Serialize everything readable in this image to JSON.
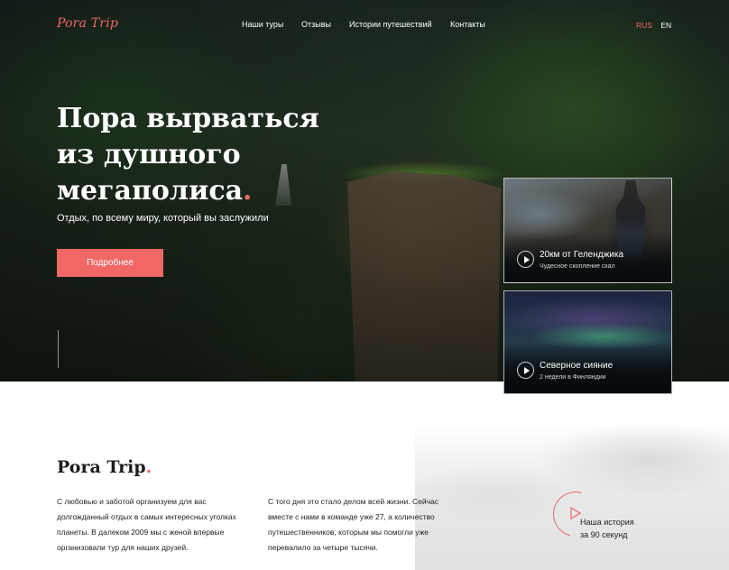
{
  "brand": {
    "logo": "Pora Trip",
    "accent_color": "#f06766"
  },
  "nav": {
    "items": [
      "Наши туры",
      "Отзывы",
      "Истории путешествий",
      "Контакты"
    ]
  },
  "lang": {
    "ru": "RUS",
    "en": "EN",
    "active": "RUS"
  },
  "hero": {
    "title_lines": [
      "Пора вырваться",
      "из душного",
      "мегаполиса"
    ],
    "title_dot": ".",
    "subtitle": "Отдых, по всему миру, который вы заслужили",
    "button": "Подробнее"
  },
  "cards": [
    {
      "title": "20км от Геленджика",
      "subtitle": "Чудесное скопление скал",
      "icon": "play-icon"
    },
    {
      "title": "Северное сияние",
      "subtitle": "2 недели в Финляндии",
      "icon": "play-icon"
    }
  ],
  "about": {
    "title": "Pora Trip",
    "title_dot": ".",
    "col1": "С любовью и заботой организуем для вас долгожданный отдых в самых интересных уголках планеты. В далеком 2009 мы с женой впервые организовали тур для наших друзей.",
    "col2": "С того дня это стало делом всей жизни. Сейчас вместе с нами в команде уже 27, а количество путешественников, которым мы помогли уже перевалило за четыре тысячи.",
    "story_line1": "Наша история",
    "story_line2": "за 90 секунд"
  }
}
